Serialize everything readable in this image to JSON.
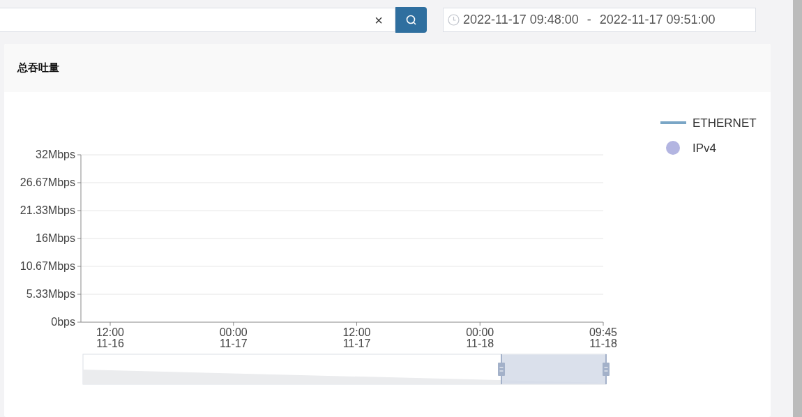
{
  "search": {
    "clear_icon": "×"
  },
  "time_range": {
    "start": "2022-11-17 09:48:00",
    "separator": "-",
    "end": "2022-11-17 09:51:00"
  },
  "card": {
    "title": "总吞吐量",
    "chart_data": {
      "type": "line",
      "ylim": [
        0,
        32
      ],
      "grid": true,
      "yticks": [
        {
          "value": 0,
          "label": "0bps"
        },
        {
          "value": 5.333,
          "label": "5.33Mbps"
        },
        {
          "value": 10.667,
          "label": "10.67Mbps"
        },
        {
          "value": 16,
          "label": "16Mbps"
        },
        {
          "value": 21.333,
          "label": "21.33Mbps"
        },
        {
          "value": 26.667,
          "label": "26.67Mbps"
        },
        {
          "value": 32,
          "label": "32Mbps"
        }
      ],
      "categories": [
        "12:00\n11-16",
        "00:00\n11-17",
        "12:00\n11-17",
        "00:00\n11-18",
        "09:45\n11-18"
      ]
    },
    "legend": [
      {
        "name": "ETHERNET",
        "color": "#7aa6c6",
        "kind": "line"
      },
      {
        "name": "IPv4",
        "color": "#b3b5e1",
        "kind": "dot"
      }
    ]
  }
}
